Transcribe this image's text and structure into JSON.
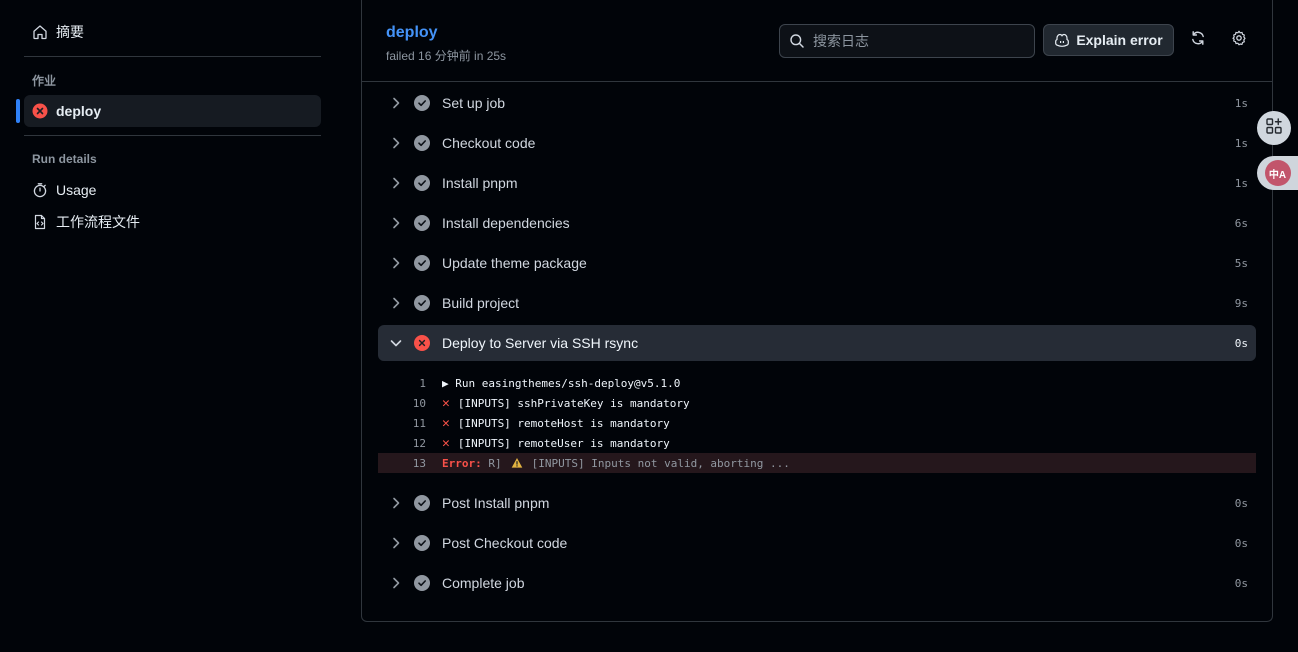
{
  "sidebar": {
    "summary_label": "摘要",
    "jobs_heading": "作业",
    "active_job": "deploy",
    "run_details_heading": "Run details",
    "usage_label": "Usage",
    "workflow_file_label": "工作流程文件"
  },
  "header": {
    "job_title": "deploy",
    "job_status": "failed 16 分钟前 in 25s",
    "search_placeholder": "搜索日志",
    "explain_label": "Explain error"
  },
  "steps_before": [
    {
      "name": "Set up job",
      "duration": "1s"
    },
    {
      "name": "Checkout code",
      "duration": "1s"
    },
    {
      "name": "Install pnpm",
      "duration": "1s"
    },
    {
      "name": "Install dependencies",
      "duration": "6s"
    },
    {
      "name": "Update theme package",
      "duration": "5s"
    },
    {
      "name": "Build project",
      "duration": "9s"
    }
  ],
  "failed_step": {
    "name": "Deploy to Server via SSH rsync",
    "duration": "0s"
  },
  "log_lines": [
    {
      "num": "1",
      "text": "▶ Run easingthemes/ssh-deploy@v5.1.0"
    },
    {
      "num": "10",
      "text": "[INPUTS] sshPrivateKey is mandatory"
    },
    {
      "num": "11",
      "text": "[INPUTS] remoteHost is mandatory"
    },
    {
      "num": "12",
      "text": "[INPUTS] remoteUser is mandatory"
    },
    {
      "num": "13",
      "error_label": "Error:",
      "before_icon": " R]",
      "text": "[INPUTS] Inputs not valid, aborting ..."
    }
  ],
  "steps_after": [
    {
      "name": "Post Install pnpm",
      "duration": "0s"
    },
    {
      "name": "Post Checkout code",
      "duration": "0s"
    },
    {
      "name": "Complete job",
      "duration": "0s"
    }
  ],
  "float_buttons": {
    "translate_label": "中A"
  },
  "colors": {
    "accent": "#2f81f7",
    "link": "#4493f8",
    "danger": "#f85149",
    "success_gray": "#9198a1"
  }
}
